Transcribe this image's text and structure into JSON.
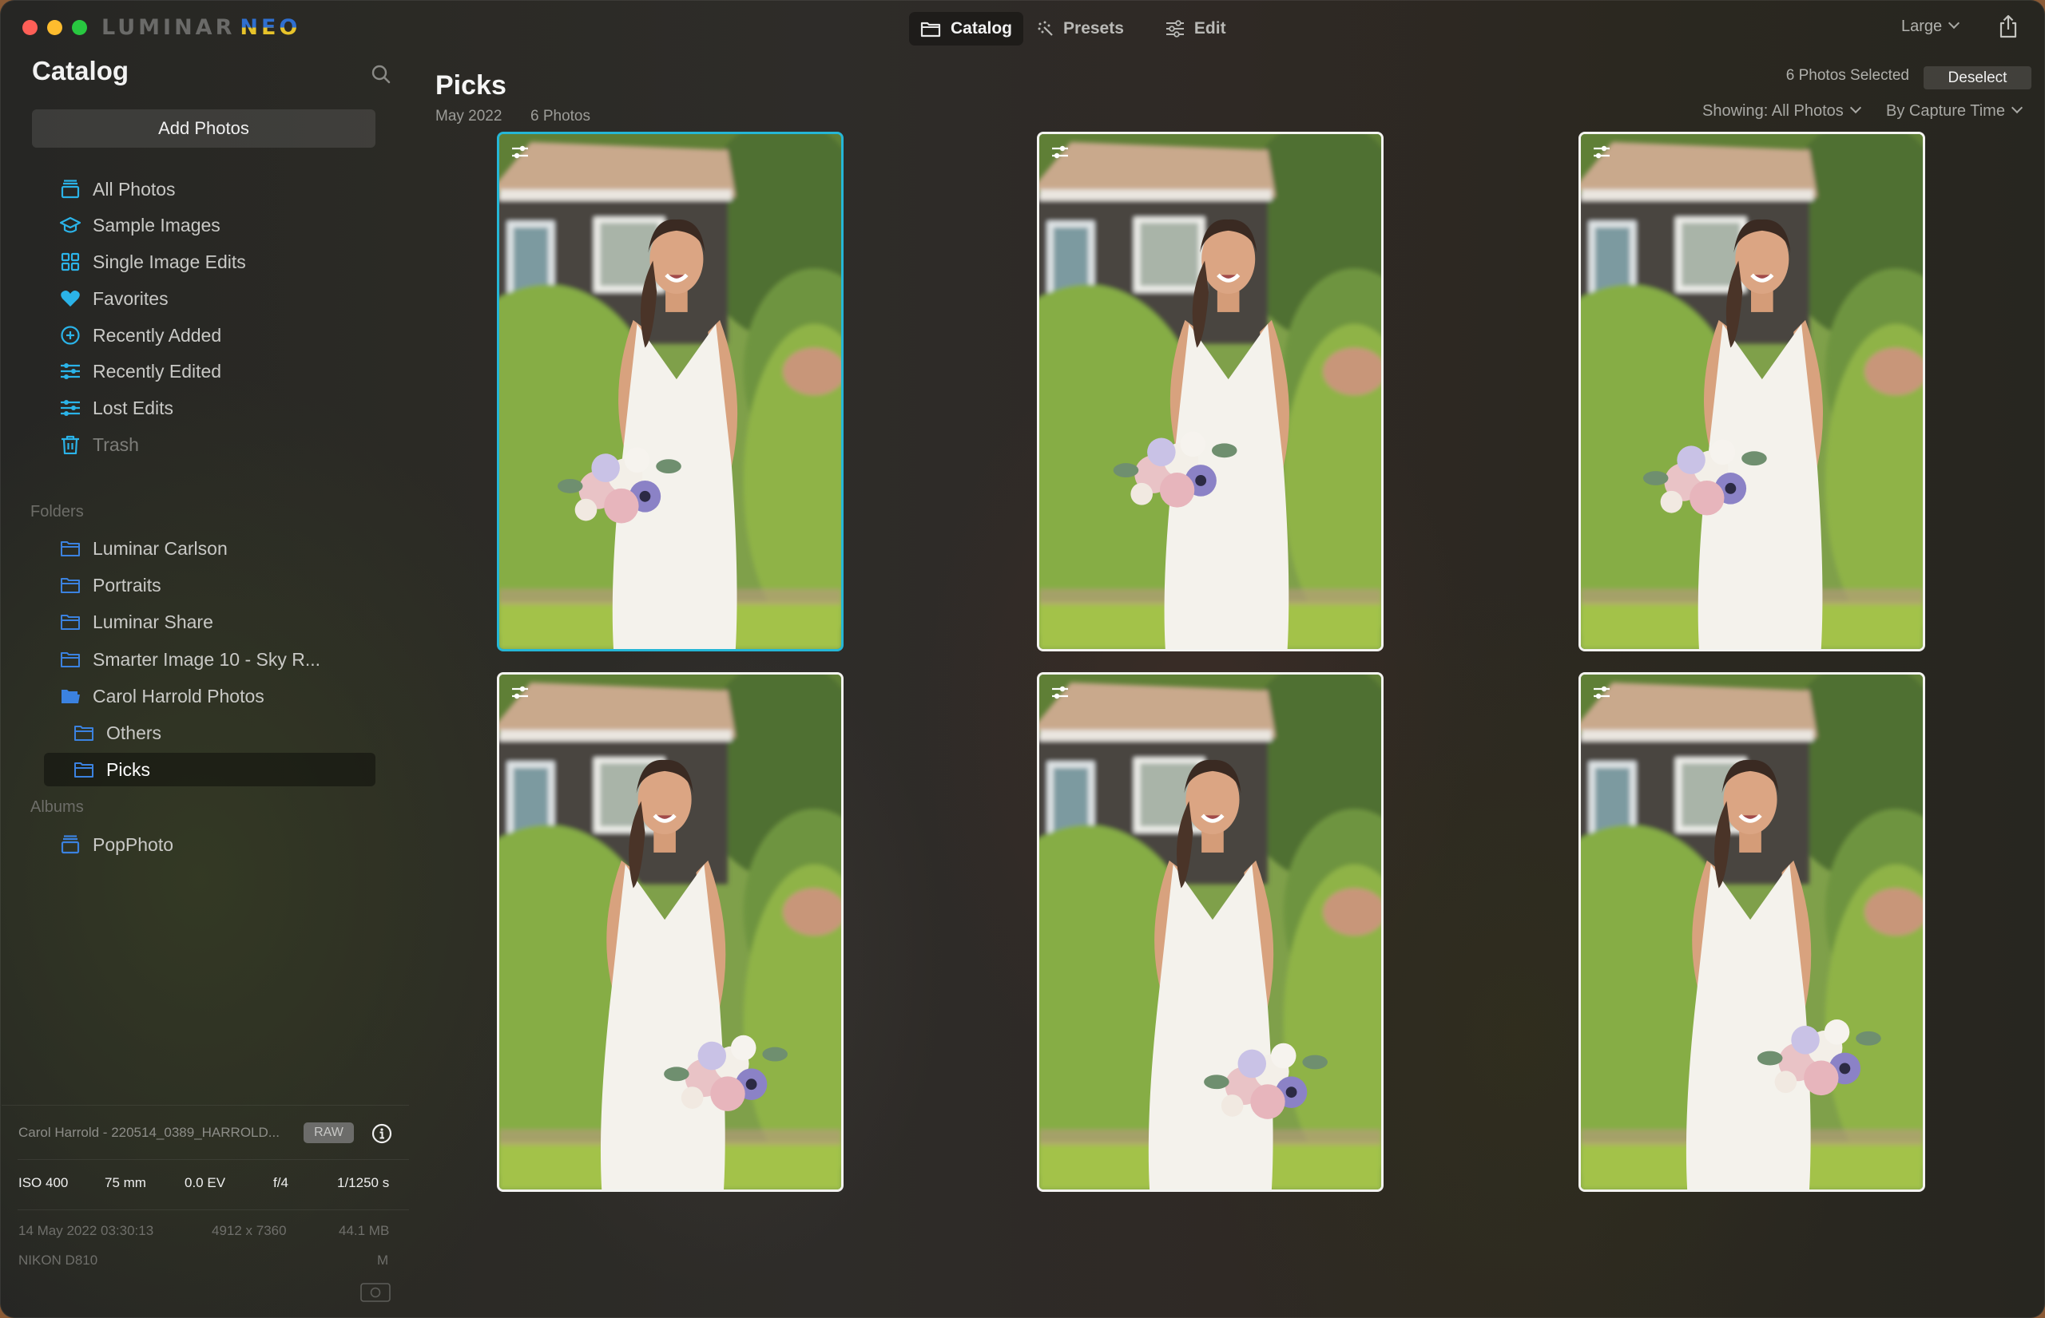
{
  "app": {
    "name_part1": "LUMINAR",
    "name_part2": "NEO"
  },
  "toolbar": {
    "tabs": [
      {
        "label": "Catalog",
        "icon": "folder-icon",
        "active": true
      },
      {
        "label": "Presets",
        "icon": "magic-wand-icon",
        "active": false
      },
      {
        "label": "Edit",
        "icon": "sliders-icon",
        "active": false
      }
    ],
    "view_size": "Large",
    "share_icon": "share-icon"
  },
  "sidebar": {
    "title": "Catalog",
    "search_icon": "search-icon",
    "add_photos_label": "Add Photos",
    "items": [
      {
        "label": "All Photos",
        "icon": "stack-icon"
      },
      {
        "label": "Sample Images",
        "icon": "graduation-cap-icon"
      },
      {
        "label": "Single Image Edits",
        "icon": "grid-icon"
      },
      {
        "label": "Favorites",
        "icon": "heart-icon"
      },
      {
        "label": "Recently Added",
        "icon": "plus-circle-icon"
      },
      {
        "label": "Recently Edited",
        "icon": "sliders-icon"
      },
      {
        "label": "Lost Edits",
        "icon": "sliders-icon"
      },
      {
        "label": "Trash",
        "icon": "trash-icon"
      }
    ],
    "folders_label": "Folders",
    "folders": [
      {
        "label": "Luminar Carlson"
      },
      {
        "label": "Portraits"
      },
      {
        "label": "Luminar Share"
      },
      {
        "label": "Smarter Image 10 - Sky R..."
      },
      {
        "label": "Carol Harrold Photos",
        "open": true
      },
      {
        "label": "Others",
        "child": true
      },
      {
        "label": "Picks",
        "child": true,
        "selected": true
      }
    ],
    "albums_label": "Albums",
    "albums": [
      {
        "label": "PopPhoto"
      }
    ],
    "accent_color": "#2bb3e8",
    "folder_icon_color": "#3b82e0"
  },
  "info_panel": {
    "filename": "Carol Harrold - 220514_0389_HARROLD...",
    "format_badge": "RAW",
    "iso": "ISO 400",
    "focal_length": "75 mm",
    "exposure_comp": "0.0 EV",
    "aperture": "f/4",
    "shutter": "1/1250 s",
    "date": "14 May 2022 03:30:13",
    "dimensions": "4912 x 7360",
    "file_size": "44.1 MB",
    "camera": "NIKON D810",
    "mode": "M"
  },
  "main": {
    "title": "Picks",
    "date": "May 2022",
    "count": "6 Photos",
    "selection_status": "6 Photos Selected",
    "deselect_label": "Deselect",
    "filter": "Showing: All Photos",
    "sort": "By Capture Time",
    "selection_color": "#25b6d6",
    "photos": [
      {
        "alt": "Bride laughing holding bouquet in front of house",
        "edited": true,
        "focused": true
      },
      {
        "alt": "Bride smiling holding bouquet in front of house",
        "edited": true,
        "focused": false
      },
      {
        "alt": "Bride smiling, head tilted, holding bouquet",
        "edited": true,
        "focused": false
      },
      {
        "alt": "Bride posed at angle with bouquet at hip",
        "edited": true,
        "focused": false
      },
      {
        "alt": "Bride smiling with bouquet at hip",
        "edited": true,
        "focused": false
      },
      {
        "alt": "Bride looking away smiling with bouquet",
        "edited": true,
        "focused": false
      }
    ]
  }
}
